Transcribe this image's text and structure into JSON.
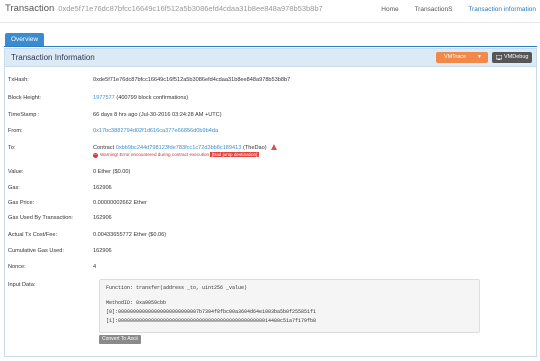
{
  "header": {
    "brand": "Transaction",
    "hash": "0xde5f71e76dc87bfcc16649c16f512a5b3086efd4cdaa31b8ee848a978b53b8b7",
    "nav": [
      {
        "label": "Home",
        "active": false
      },
      {
        "label": "TransactionS",
        "active": false
      },
      {
        "label": "Transaction information",
        "active": true
      }
    ]
  },
  "tabs": {
    "overview": "Overview"
  },
  "panel": {
    "title": "Transaction Information",
    "vmtrace_label": "VMTrace",
    "vmdebug_label": "VMDebug"
  },
  "fields": {
    "txhash": {
      "label": "TxHash:",
      "value": "0xde5f71e76dc87bfcc16649c16f512a5b3086efd4cdaa31b8ee848a978b53b8b7"
    },
    "block": {
      "label": "Block Height:",
      "link": "1977577",
      "extra": "(400799 block confirmations)"
    },
    "timestamp": {
      "label": "TimeStamp :",
      "value": "66 days 8 hrs ago (Jul-30-2016 03:24:28 AM +UTC)"
    },
    "from": {
      "label": "From:",
      "link": "0x17bc3882794d02f1d616ca377e66856d0b9b4da"
    },
    "to": {
      "label": "To:",
      "prefix": "Contract",
      "link": "0xbb9bc244d798123fde783fcc1c72d3bb8c189413",
      "name": "(TheDao)",
      "warning_text": "Warning! Error encountered during contract execution",
      "warning_badge": "[Bad jump destination]"
    },
    "value": {
      "label": "Value:",
      "value": "0 Ether ($0.00)"
    },
    "gas": {
      "label": "Gas:",
      "value": "162906"
    },
    "gas_price": {
      "label": "Gas Price:",
      "value": "0.00000002662 Ether"
    },
    "gas_used": {
      "label": "Gas Used By Transaction:",
      "value": "162906"
    },
    "cost": {
      "label": "Actual Tx Cost/Fee:",
      "value": "0.00433655772 Ether ($0.06)"
    },
    "cumulative": {
      "label": "Cumulative Gas Used:",
      "value": "162906"
    },
    "nonce": {
      "label": "Nonce:",
      "value": "4"
    },
    "input": {
      "label": "Input Data:",
      "function": "Function: transfer(address _to, uint256 _value)",
      "method_id": "MethodID: 0xa9059cbb",
      "param0": "[0]:000000000000000000000000007b7394f8fbc00a3604d64e1003ba5b0f255851f1",
      "param1": "[1]:000000000000000000000000000000000000000000000000014480c51a7f179fb8",
      "convert_label": "Convert To Ascii"
    }
  },
  "colors": {
    "accent": "#3a8bd0",
    "trace_btn": "#f0894a",
    "debug_btn": "#565656",
    "warning": "#d9534f"
  }
}
